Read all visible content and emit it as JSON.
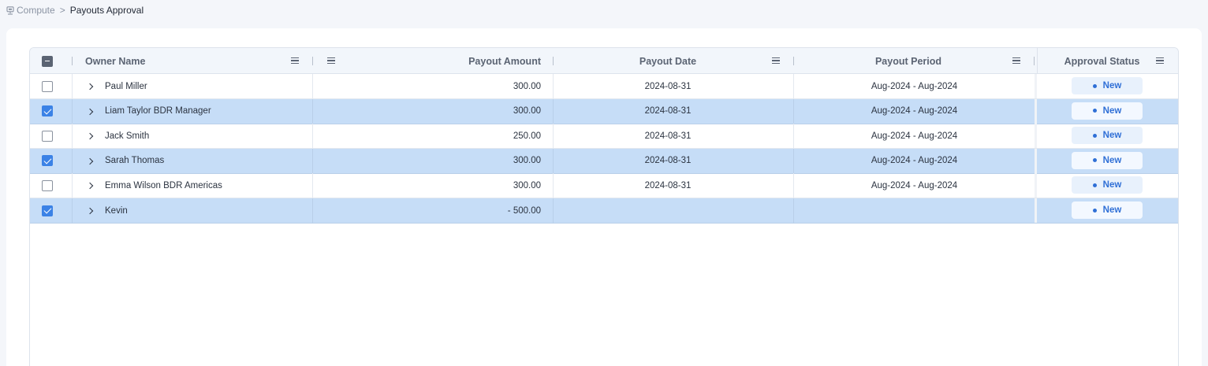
{
  "breadcrumb": {
    "icon": "compute-icon",
    "parent": "Compute",
    "separator": ">",
    "current": "Payouts Approval"
  },
  "grid": {
    "columns": {
      "owner_name": "Owner Name",
      "payout_amount": "Payout Amount",
      "payout_date": "Payout Date",
      "payout_period": "Payout Period",
      "approval_status": "Approval Status"
    },
    "header_checkbox_state": "indeterminate",
    "rows": [
      {
        "selected": false,
        "owner": "Paul Miller",
        "amount": "300.00",
        "date": "2024-08-31",
        "period": "Aug-2024 - Aug-2024",
        "status": "New"
      },
      {
        "selected": true,
        "owner": "Liam Taylor BDR Manager",
        "amount": "300.00",
        "date": "2024-08-31",
        "period": "Aug-2024 - Aug-2024",
        "status": "New"
      },
      {
        "selected": false,
        "owner": "Jack Smith",
        "amount": "250.00",
        "date": "2024-08-31",
        "period": "Aug-2024 - Aug-2024",
        "status": "New"
      },
      {
        "selected": true,
        "owner": "Sarah Thomas",
        "amount": "300.00",
        "date": "2024-08-31",
        "period": "Aug-2024 - Aug-2024",
        "status": "New"
      },
      {
        "selected": false,
        "owner": "Emma Wilson BDR Americas",
        "amount": "300.00",
        "date": "2024-08-31",
        "period": "Aug-2024 - Aug-2024",
        "status": "New"
      },
      {
        "selected": true,
        "owner": "Kevin",
        "amount": "- 500.00",
        "date": "",
        "period": "",
        "status": "New"
      }
    ]
  },
  "colors": {
    "selected_row": "#c6ddf7",
    "checkbox_checked": "#3b82e6",
    "status_text": "#2f6fd6",
    "status_badge_bg": "#e8f1fc"
  }
}
